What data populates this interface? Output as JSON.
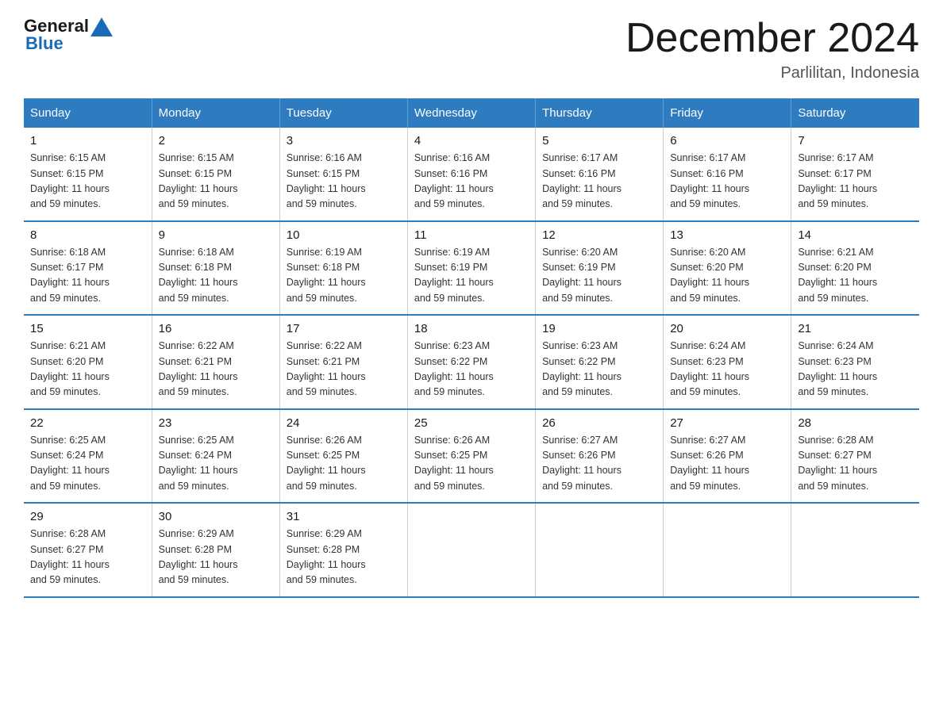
{
  "header": {
    "logo": {
      "general": "General",
      "blue": "Blue"
    },
    "title": "December 2024",
    "location": "Parlilitan, Indonesia"
  },
  "weekdays": [
    "Sunday",
    "Monday",
    "Tuesday",
    "Wednesday",
    "Thursday",
    "Friday",
    "Saturday"
  ],
  "weeks": [
    [
      {
        "day": "1",
        "sunrise": "6:15 AM",
        "sunset": "6:15 PM",
        "daylight": "11 hours and 59 minutes."
      },
      {
        "day": "2",
        "sunrise": "6:15 AM",
        "sunset": "6:15 PM",
        "daylight": "11 hours and 59 minutes."
      },
      {
        "day": "3",
        "sunrise": "6:16 AM",
        "sunset": "6:15 PM",
        "daylight": "11 hours and 59 minutes."
      },
      {
        "day": "4",
        "sunrise": "6:16 AM",
        "sunset": "6:16 PM",
        "daylight": "11 hours and 59 minutes."
      },
      {
        "day": "5",
        "sunrise": "6:17 AM",
        "sunset": "6:16 PM",
        "daylight": "11 hours and 59 minutes."
      },
      {
        "day": "6",
        "sunrise": "6:17 AM",
        "sunset": "6:16 PM",
        "daylight": "11 hours and 59 minutes."
      },
      {
        "day": "7",
        "sunrise": "6:17 AM",
        "sunset": "6:17 PM",
        "daylight": "11 hours and 59 minutes."
      }
    ],
    [
      {
        "day": "8",
        "sunrise": "6:18 AM",
        "sunset": "6:17 PM",
        "daylight": "11 hours and 59 minutes."
      },
      {
        "day": "9",
        "sunrise": "6:18 AM",
        "sunset": "6:18 PM",
        "daylight": "11 hours and 59 minutes."
      },
      {
        "day": "10",
        "sunrise": "6:19 AM",
        "sunset": "6:18 PM",
        "daylight": "11 hours and 59 minutes."
      },
      {
        "day": "11",
        "sunrise": "6:19 AM",
        "sunset": "6:19 PM",
        "daylight": "11 hours and 59 minutes."
      },
      {
        "day": "12",
        "sunrise": "6:20 AM",
        "sunset": "6:19 PM",
        "daylight": "11 hours and 59 minutes."
      },
      {
        "day": "13",
        "sunrise": "6:20 AM",
        "sunset": "6:20 PM",
        "daylight": "11 hours and 59 minutes."
      },
      {
        "day": "14",
        "sunrise": "6:21 AM",
        "sunset": "6:20 PM",
        "daylight": "11 hours and 59 minutes."
      }
    ],
    [
      {
        "day": "15",
        "sunrise": "6:21 AM",
        "sunset": "6:20 PM",
        "daylight": "11 hours and 59 minutes."
      },
      {
        "day": "16",
        "sunrise": "6:22 AM",
        "sunset": "6:21 PM",
        "daylight": "11 hours and 59 minutes."
      },
      {
        "day": "17",
        "sunrise": "6:22 AM",
        "sunset": "6:21 PM",
        "daylight": "11 hours and 59 minutes."
      },
      {
        "day": "18",
        "sunrise": "6:23 AM",
        "sunset": "6:22 PM",
        "daylight": "11 hours and 59 minutes."
      },
      {
        "day": "19",
        "sunrise": "6:23 AM",
        "sunset": "6:22 PM",
        "daylight": "11 hours and 59 minutes."
      },
      {
        "day": "20",
        "sunrise": "6:24 AM",
        "sunset": "6:23 PM",
        "daylight": "11 hours and 59 minutes."
      },
      {
        "day": "21",
        "sunrise": "6:24 AM",
        "sunset": "6:23 PM",
        "daylight": "11 hours and 59 minutes."
      }
    ],
    [
      {
        "day": "22",
        "sunrise": "6:25 AM",
        "sunset": "6:24 PM",
        "daylight": "11 hours and 59 minutes."
      },
      {
        "day": "23",
        "sunrise": "6:25 AM",
        "sunset": "6:24 PM",
        "daylight": "11 hours and 59 minutes."
      },
      {
        "day": "24",
        "sunrise": "6:26 AM",
        "sunset": "6:25 PM",
        "daylight": "11 hours and 59 minutes."
      },
      {
        "day": "25",
        "sunrise": "6:26 AM",
        "sunset": "6:25 PM",
        "daylight": "11 hours and 59 minutes."
      },
      {
        "day": "26",
        "sunrise": "6:27 AM",
        "sunset": "6:26 PM",
        "daylight": "11 hours and 59 minutes."
      },
      {
        "day": "27",
        "sunrise": "6:27 AM",
        "sunset": "6:26 PM",
        "daylight": "11 hours and 59 minutes."
      },
      {
        "day": "28",
        "sunrise": "6:28 AM",
        "sunset": "6:27 PM",
        "daylight": "11 hours and 59 minutes."
      }
    ],
    [
      {
        "day": "29",
        "sunrise": "6:28 AM",
        "sunset": "6:27 PM",
        "daylight": "11 hours and 59 minutes."
      },
      {
        "day": "30",
        "sunrise": "6:29 AM",
        "sunset": "6:28 PM",
        "daylight": "11 hours and 59 minutes."
      },
      {
        "day": "31",
        "sunrise": "6:29 AM",
        "sunset": "6:28 PM",
        "daylight": "11 hours and 59 minutes."
      },
      null,
      null,
      null,
      null
    ]
  ],
  "labels": {
    "sunrise": "Sunrise:",
    "sunset": "Sunset:",
    "daylight": "Daylight:"
  }
}
